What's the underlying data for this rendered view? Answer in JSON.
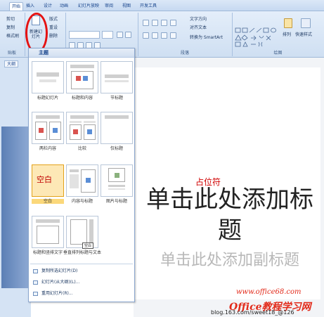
{
  "tabs": [
    "开始",
    "插入",
    "设计",
    "动画",
    "幻灯片放映",
    "审阅",
    "视图",
    "开发工具"
  ],
  "ribbon": {
    "clipboard": {
      "cut": "剪切",
      "copy": "复制",
      "format_painter": "格式刷"
    },
    "slides": {
      "new_slide": "新建幻灯片",
      "layout": "版式",
      "reset": "重设",
      "delete": "删除"
    },
    "paragraph": {
      "text_direction": "文字方向",
      "align_text": "对齐文本",
      "smartart": "转换为 SmartArt"
    },
    "drawing": {
      "arrange": "排列",
      "quick_styles": "快速样式"
    },
    "group_labels": {
      "clipboard": "贴板",
      "paragraph": "段落",
      "drawing": "绘图"
    }
  },
  "left_pane": {
    "outline_tab": "大纲"
  },
  "gallery": {
    "header": "主题",
    "layouts": [
      {
        "name": "标题幻灯片"
      },
      {
        "name": "标题和内容"
      },
      {
        "name": "节标题"
      },
      {
        "name": "两栏内容"
      },
      {
        "name": "比较"
      },
      {
        "name": "仅标题"
      },
      {
        "name": "空白"
      },
      {
        "name": "内容与标题"
      },
      {
        "name": "图片与标题"
      },
      {
        "name": "标题和竖排文字"
      },
      {
        "name": "垂直排列标题与文本"
      }
    ],
    "empty_annotation": "空白",
    "tooltip": "空白",
    "menu": [
      "复制所选幻灯片(D)",
      "幻灯片(从大纲)(L)...",
      "重用幻灯片(R)..."
    ]
  },
  "slide": {
    "title": "单击此处添加标题",
    "subtitle": "单击此处添加副标题",
    "annotation": "占位符"
  },
  "watermark": {
    "brand": "Office教程学习网",
    "url": "www.office68.com",
    "blog": "blog.163.com/sweet18_@126"
  },
  "colors": {
    "accent": "#15428b",
    "highlight": "#fbd87a",
    "annotation_red": "#e51212"
  }
}
